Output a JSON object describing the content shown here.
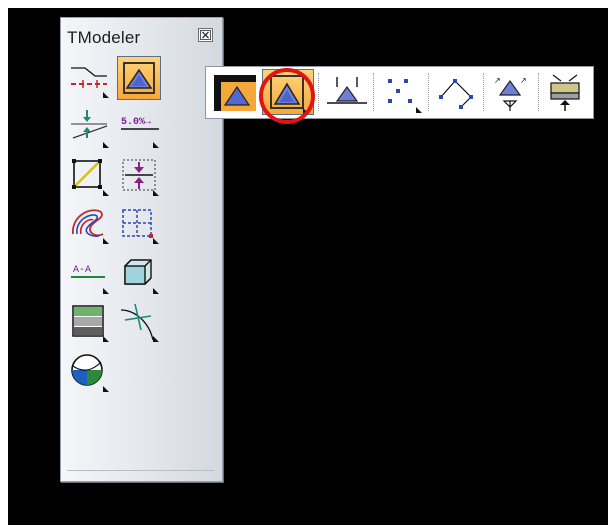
{
  "window": {
    "title": "TModeler"
  },
  "tools": [
    {
      "id": "breaklines",
      "icon": "breakline-icon"
    },
    {
      "id": "surface-from-points",
      "icon": "surface-triangle-icon",
      "active": true
    },
    {
      "id": "elevation-adjust",
      "icon": "elevation-arrows-icon"
    },
    {
      "id": "slope-label",
      "icon": "slope-label-icon",
      "label": "5.0%→"
    },
    {
      "id": "boundary",
      "icon": "diagonal-box-icon"
    },
    {
      "id": "raise-lower",
      "icon": "raise-lower-icon"
    },
    {
      "id": "contours",
      "icon": "contour-icon"
    },
    {
      "id": "grid-edit",
      "icon": "grid-edit-icon"
    },
    {
      "id": "section",
      "icon": "section-icon",
      "label": "A-A"
    },
    {
      "id": "3d-view",
      "icon": "cube-icon"
    },
    {
      "id": "layers",
      "icon": "layers-icon"
    },
    {
      "id": "intersect",
      "icon": "intersect-icon"
    },
    {
      "id": "sphere",
      "icon": "sphere-icon"
    }
  ],
  "flyout": [
    {
      "id": "fly-surface-frame",
      "icon": "surface-frame-icon"
    },
    {
      "id": "fly-surface-triangle",
      "icon": "surface-triangle-icon",
      "active": true
    },
    {
      "id": "fly-surface-level",
      "icon": "surface-level-icon"
    },
    {
      "id": "fly-points",
      "icon": "points-icon"
    },
    {
      "id": "fly-polyline",
      "icon": "polyline-points-icon"
    },
    {
      "id": "fly-elevation-points",
      "icon": "elevation-points-icon"
    },
    {
      "id": "fly-slab",
      "icon": "slab-icon"
    }
  ],
  "colors": {
    "accent_orange": "#f5a83a",
    "accent_blue": "#3f6fd0",
    "highlight_red": "#e01414",
    "background": "#000000"
  }
}
